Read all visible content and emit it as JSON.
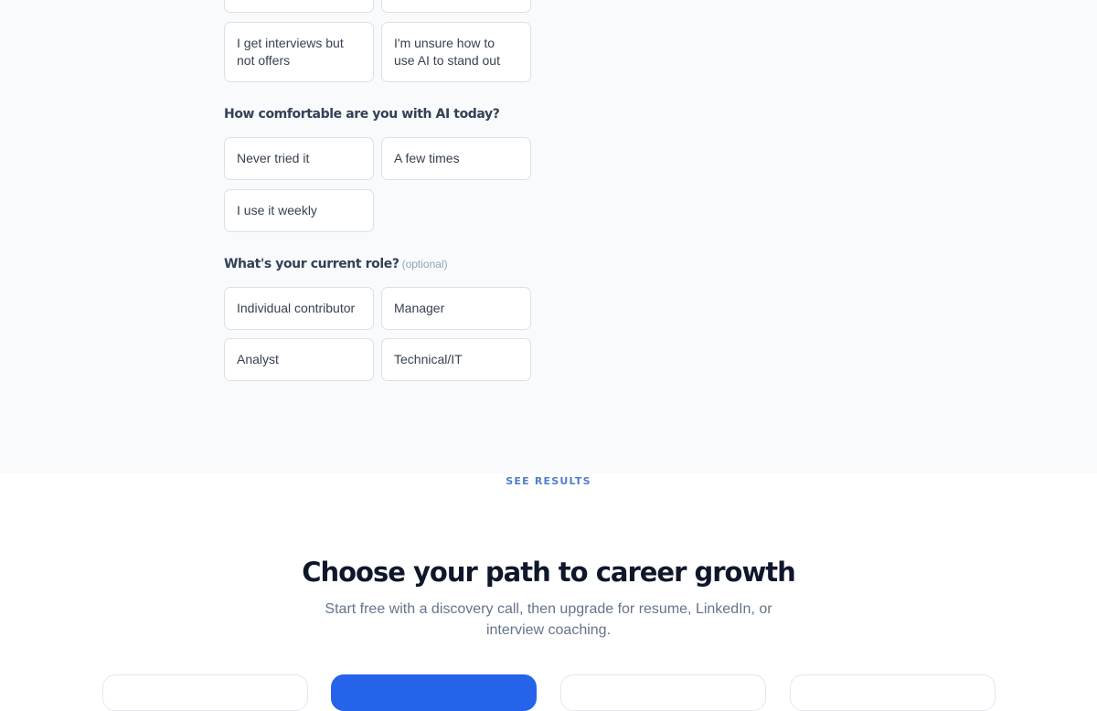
{
  "quiz": {
    "challenge_options": [
      "I get interviews but not offers",
      "I'm unsure how to use AI to stand out"
    ],
    "ai_comfort": {
      "question": "How comfortable are you with AI today?",
      "options": [
        "Never tried it",
        "A few times",
        "I use it weekly"
      ]
    },
    "current_role": {
      "question": "What's your current role?",
      "optional_note": "(optional)",
      "options": [
        "Individual contributor",
        "Manager",
        "Analyst",
        "Technical/IT"
      ]
    }
  },
  "see_results": {
    "label": "SEE RESULTS"
  },
  "pricing": {
    "title": "Choose your path to career growth",
    "subtitle": "Start free with a discovery call, then upgrade for resume, LinkedIn, or interview coaching."
  },
  "colors": {
    "quiz_background": "#f8fafc",
    "accent": "#2563eb",
    "see_results": "#4f7ec8",
    "heading": "#0f172a"
  }
}
